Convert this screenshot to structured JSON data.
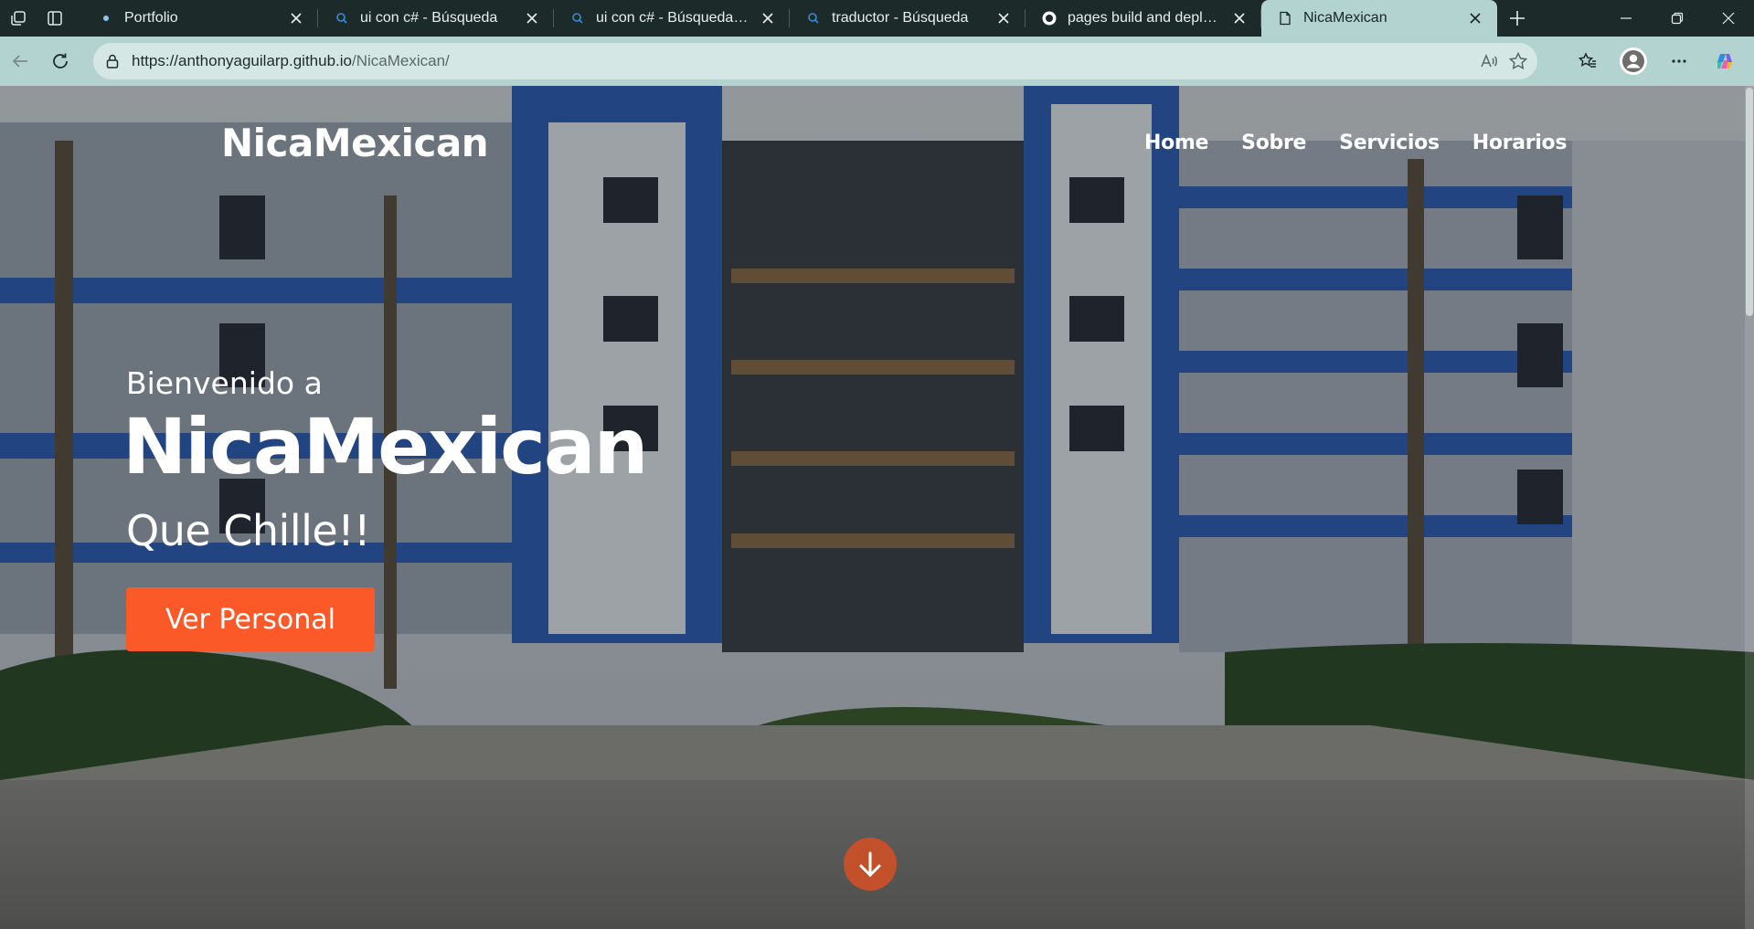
{
  "browser": {
    "tabs": [
      {
        "title": "Portfolio",
        "favicon": "portfolio-dot-icon"
      },
      {
        "title": "ui con c# - Búsqueda",
        "favicon": "search-icon"
      },
      {
        "title": "ui con c# - Búsqueda Imágenes",
        "favicon": "search-icon"
      },
      {
        "title": "traductor - Búsqueda",
        "favicon": "search-icon"
      },
      {
        "title": "pages build and deployment",
        "favicon": "github-icon"
      },
      {
        "title": "NicaMexican",
        "favicon": "page-icon",
        "active": true
      }
    ],
    "url_host": "https://anthonyaguilarp.github.io",
    "url_path": "/NicaMexican/"
  },
  "site": {
    "logo": "NicaMexican",
    "nav": [
      "Home",
      "Sobre",
      "Servicios",
      "Horarios"
    ],
    "hero": {
      "welcome": "Bienvenido a",
      "title": "NicaMexican",
      "tagline": "Que Chille!!",
      "cta_label": "Ver Personal"
    }
  },
  "colors": {
    "tabstrip_bg": "#1d2a2a",
    "toolbar_bg": "#b3d3d0",
    "cta": "#fb5a28",
    "scroll_button": "#c2502a",
    "building_blue": "#2e5fb7"
  }
}
